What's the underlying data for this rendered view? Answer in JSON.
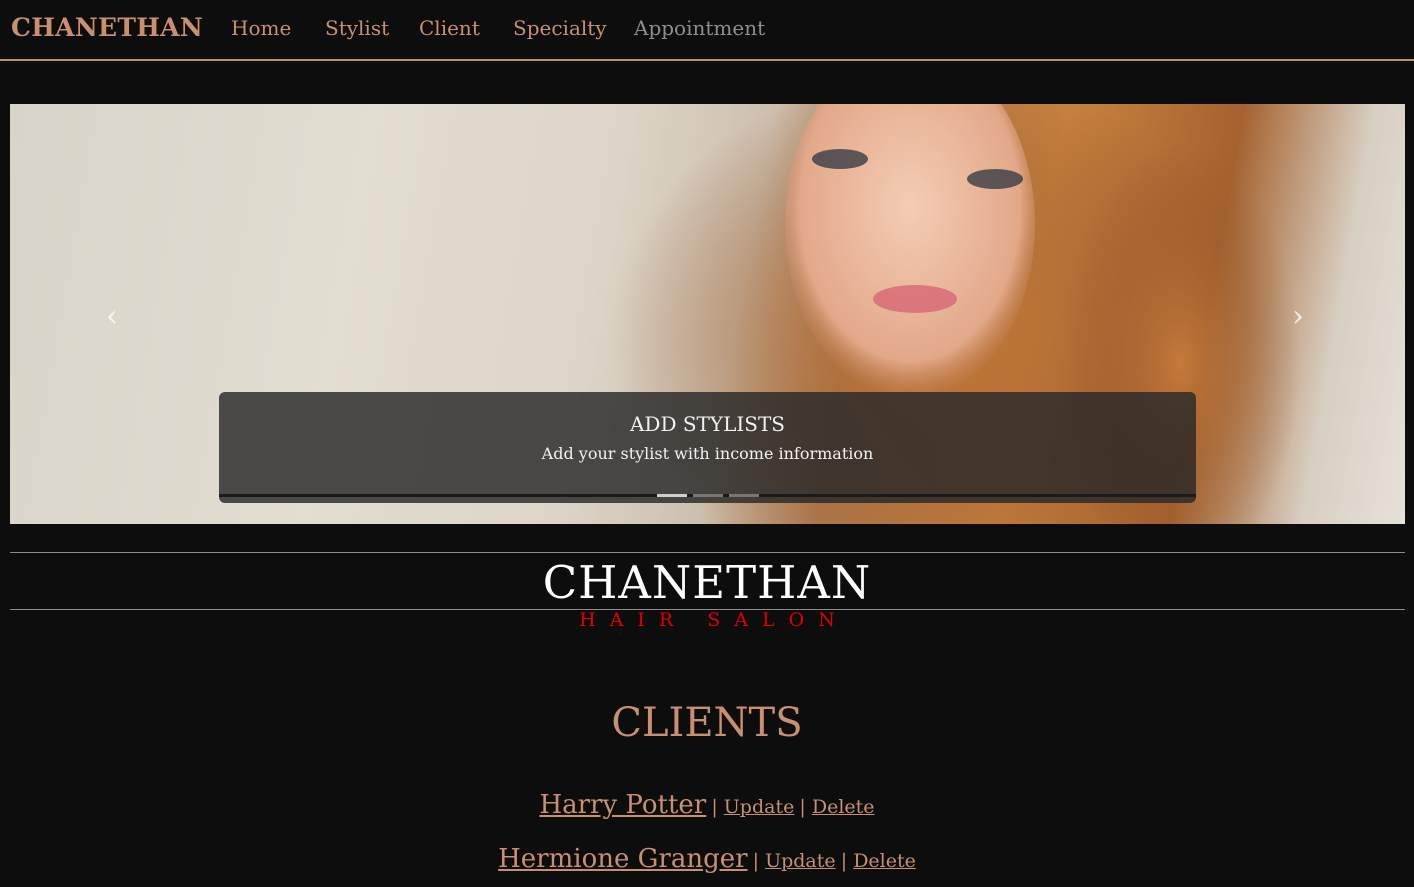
{
  "nav": {
    "brand": "CHANETHAN",
    "links": [
      "Home",
      "Stylist",
      "Client",
      "Specialty",
      "Appointment"
    ]
  },
  "carousel": {
    "prev_glyph": "‹",
    "next_glyph": "›",
    "caption_title": "ADD STYLISTS",
    "caption_text": "Add your stylist with income information",
    "slide_count": 3,
    "active_slide": 1
  },
  "logo": {
    "main": "CHANETHAN",
    "sub": "HAIR SALON"
  },
  "clients": {
    "title": "CLIENTS",
    "separator": "|",
    "update_label": "Update",
    "delete_label": "Delete",
    "items": [
      {
        "name": "Harry Potter"
      },
      {
        "name": "Hermione Granger"
      }
    ]
  },
  "colors": {
    "background": "#0d0d0d",
    "accent": "#c9906f",
    "logo_sub": "#e00000"
  },
  "icons": {
    "prev": "chevron-left-icon",
    "next": "chevron-right-icon"
  }
}
